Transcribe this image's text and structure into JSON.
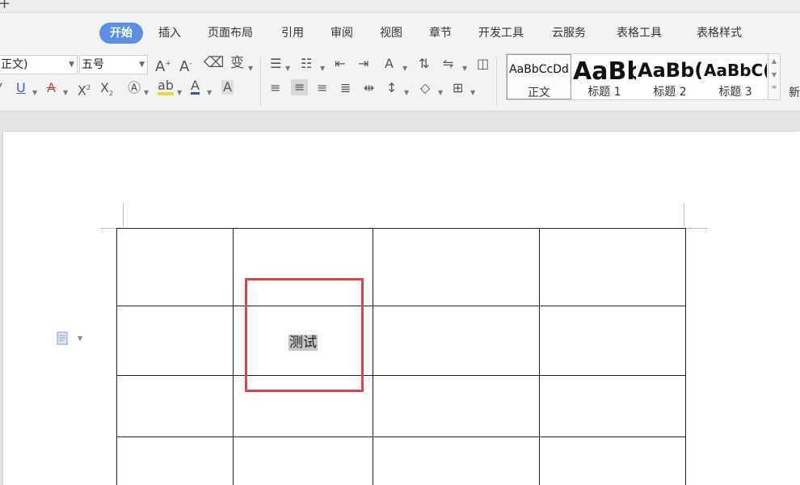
{
  "tabs": [
    "开始",
    "插入",
    "页面布局",
    "引用",
    "审阅",
    "视图",
    "章节",
    "开发工具",
    "云服务",
    "表格工具",
    "表格样式"
  ],
  "active_tab": "开始",
  "font": {
    "name": "正文)",
    "size": "五号"
  },
  "styles": [
    {
      "preview": "AaBbCcDd",
      "label": "正文"
    },
    {
      "preview": "AaBb",
      "label": "标题 1"
    },
    {
      "preview": "AaBb(",
      "label": "标题 2"
    },
    {
      "preview": "AaBbC(",
      "label": "标题 3"
    }
  ],
  "new_style_label": "新",
  "table": {
    "rows": [
      [
        "",
        "",
        "",
        ""
      ],
      [
        "",
        "测试",
        "",
        ""
      ],
      [
        "",
        "",
        "",
        ""
      ],
      [
        "",
        "",
        "",
        ""
      ]
    ]
  },
  "colors": {
    "accent": "#5b8fe6",
    "highlight_box": "#e04545",
    "selection": "#c6c6c6"
  }
}
